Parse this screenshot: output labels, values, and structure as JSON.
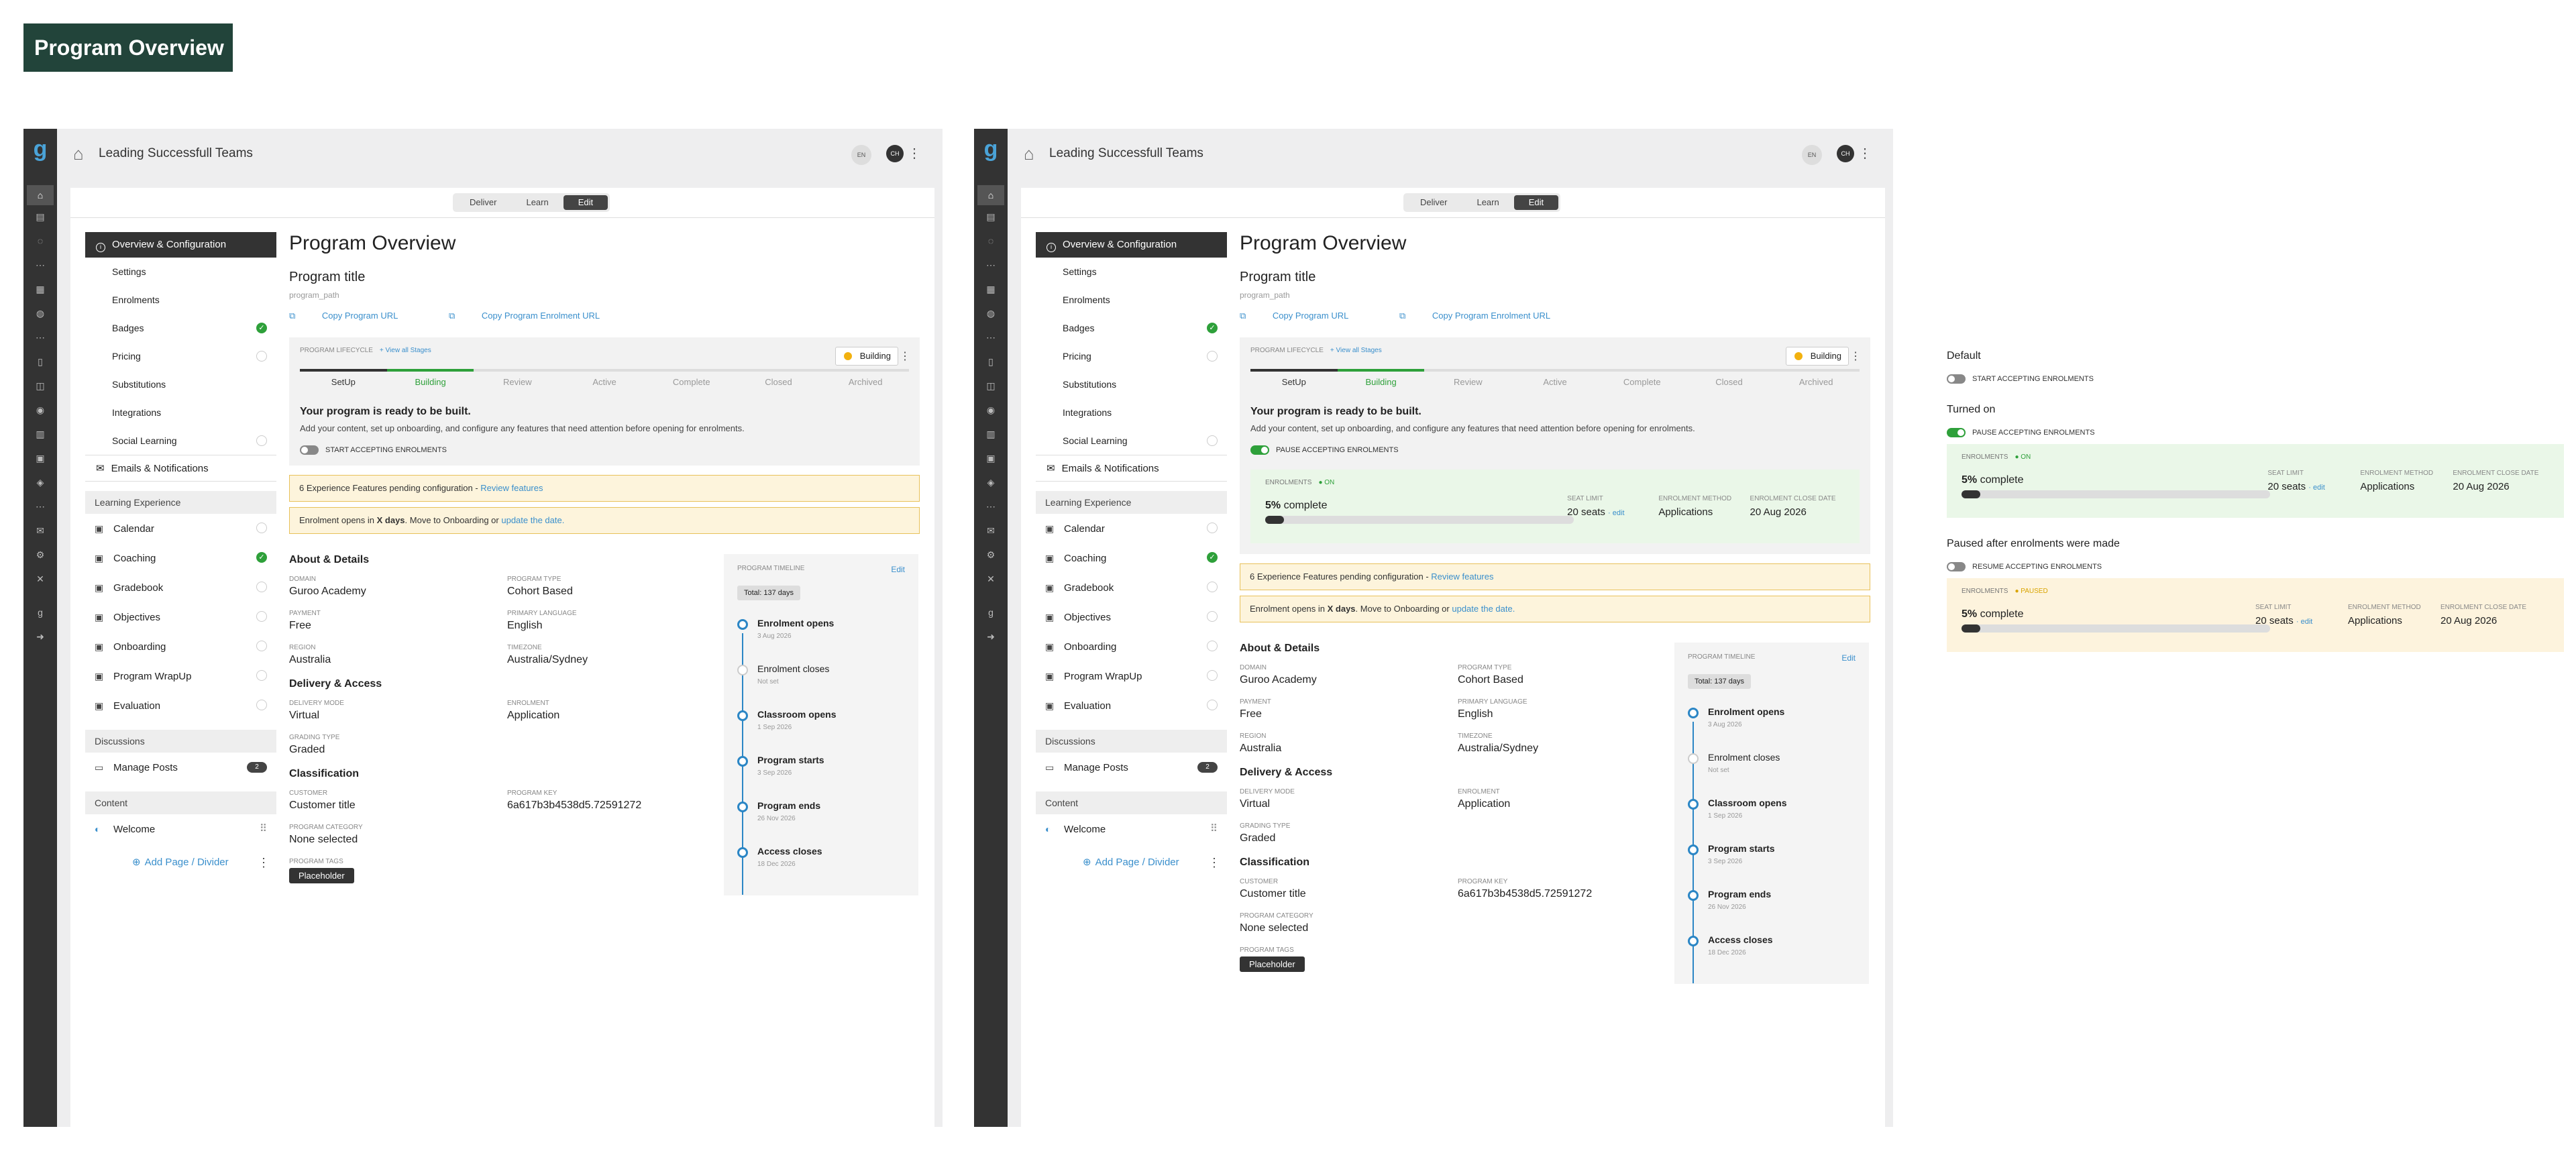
{
  "banner": {
    "title": "Program Overview"
  },
  "app": {
    "title": "Leading Successfull Teams",
    "lang": "EN",
    "user_initials": "CH",
    "tabs": [
      "Deliver",
      "Learn",
      "Edit"
    ],
    "active_tab": "Edit"
  },
  "sidebar": {
    "overview": "Overview & Configuration",
    "sub_items": [
      {
        "label": "Settings",
        "status": ""
      },
      {
        "label": "Enrolments",
        "status": ""
      },
      {
        "label": "Badges",
        "status": "done"
      },
      {
        "label": "Pricing",
        "status": "none"
      },
      {
        "label": "Substitutions",
        "status": ""
      },
      {
        "label": "Integrations",
        "status": ""
      },
      {
        "label": "Social Learning",
        "status": "none"
      }
    ],
    "emails": "Emails & Notifications",
    "learning_header": "Learning Experience",
    "learning_items": [
      {
        "label": "Calendar",
        "status": "none",
        "icon": "calendar-icon"
      },
      {
        "label": "Coaching",
        "status": "done",
        "icon": "coaching-icon"
      },
      {
        "label": "Gradebook",
        "status": "none",
        "icon": "gradebook-icon"
      },
      {
        "label": "Objectives",
        "status": "none",
        "icon": "objectives-icon"
      },
      {
        "label": "Onboarding",
        "status": "none",
        "icon": "onboarding-icon"
      },
      {
        "label": "Program WrapUp",
        "status": "none",
        "icon": "wrapup-icon"
      },
      {
        "label": "Evaluation",
        "status": "none",
        "icon": "evaluation-icon"
      }
    ],
    "discussions_header": "Discussions",
    "manage_posts": "Manage Posts",
    "manage_posts_count": "2",
    "content_header": "Content",
    "welcome": "Welcome",
    "add_page": "Add Page / Divider"
  },
  "main": {
    "heading": "Program Overview",
    "program_title": "Program title",
    "program_path": "program_path",
    "copy_url": "Copy Program URL",
    "copy_enrol_url": "Copy Program Enrolment URL",
    "lifecycle_label": "PROGRAM LIFECYCLE",
    "view_stages": "View all Stages",
    "building_chip": "Building",
    "stages": [
      "SetUp",
      "Building",
      "Review",
      "Active",
      "Complete",
      "Closed",
      "Archived"
    ],
    "ready_title": "Your program is ready to be built.",
    "ready_desc": "Add your content, set up onboarding, and configure any features that need attention before opening for enrolments.",
    "toggle_start": "START ACCEPTING ENROLMENTS",
    "toggle_pause": "PAUSE ACCEPTING ENROLMENTS",
    "alert1_text": "6 Experience Features pending configuration - ",
    "alert1_link": "Review features",
    "alert2_pre": "Enrolment opens in ",
    "alert2_bold": "X days",
    "alert2_mid": ". Move to Onboarding or ",
    "alert2_link": "update the date."
  },
  "enrolments": {
    "label": "ENROLMENTS",
    "status_on": "ON",
    "status_paused": "PAUSED",
    "pct_value": "5%",
    "pct_text": " complete",
    "progress": 0.05,
    "seat_limit_label": "SEAT LIMIT",
    "seat_limit": "20 seats",
    "seat_edit": "edit",
    "method_label": "ENROLMENT METHOD",
    "method": "Applications",
    "close_label": "ENROLMENT CLOSE DATE",
    "close": "20 Aug 2026"
  },
  "about": {
    "heading": "About & Details",
    "domain_label": "DOMAIN",
    "domain": "Guroo Academy",
    "type_label": "PROGRAM TYPE",
    "type": "Cohort Based",
    "payment_label": "PAYMENT",
    "payment": "Free",
    "language_label": "PRIMARY LANGUAGE",
    "language": "English",
    "region_label": "REGION",
    "region": "Australia",
    "tz_label": "TIMEZONE",
    "tz": "Australia/Sydney"
  },
  "delivery": {
    "heading": "Delivery & Access",
    "mode_label": "DELIVERY MODE",
    "mode": "Virtual",
    "enrolment_label": "ENROLMENT",
    "enrolment": "Application",
    "grading_label": "GRADING TYPE",
    "grading": "Graded"
  },
  "classification": {
    "heading": "Classification",
    "customer_label": "CUSTOMER",
    "customer": "Customer title",
    "key_label": "PROGRAM KEY",
    "key": "6a617b3b4538d5.72591272",
    "category_label": "PROGRAM CATEGORY",
    "category": "None selected",
    "tags_label": "PROGRAM TAGS",
    "tag": "Placeholder"
  },
  "timeline": {
    "heading": "PROGRAM TIMELINE",
    "edit": "Edit",
    "total": "Total: 137 days",
    "items": [
      {
        "title": "Enrolment opens",
        "date": "3 Aug 2026",
        "set": true
      },
      {
        "title": "Enrolment closes",
        "date": "Not set",
        "set": false
      },
      {
        "title": "Classroom opens",
        "date": "1 Sep 2026",
        "set": true
      },
      {
        "title": "Program starts",
        "date": "3 Sep 2026",
        "set": true
      },
      {
        "title": "Program ends",
        "date": "26 Nov 2026",
        "set": true
      },
      {
        "title": "Access closes",
        "date": "18 Dec 2026",
        "set": true
      }
    ]
  },
  "demo": {
    "default_heading": "Default",
    "turned_on_heading": "Turned on",
    "paused_heading": "Paused after enrolments were made",
    "resume": "RESUME ACCEPTING ENROLMENTS"
  }
}
